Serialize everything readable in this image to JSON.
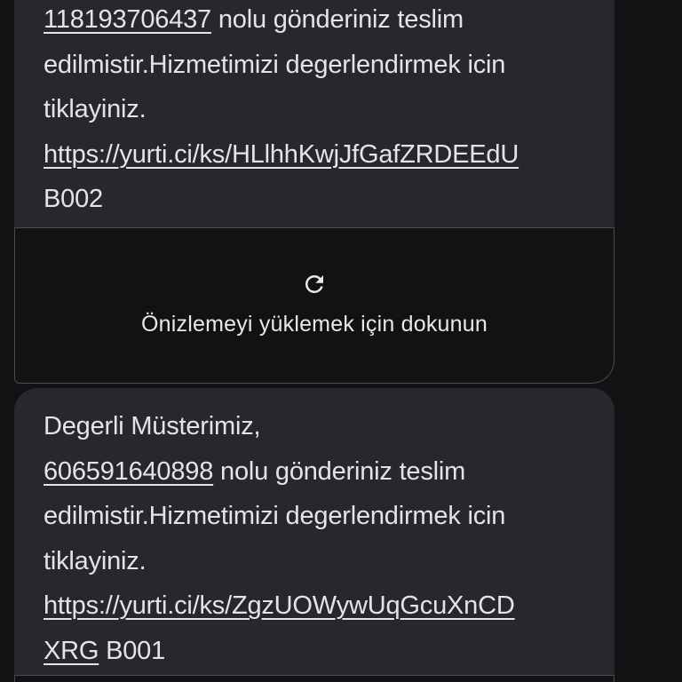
{
  "messages": [
    {
      "lines": [
        {
          "link": "118193706437",
          "text": " nolu gönderiniz teslim"
        },
        {
          "text": "edilmistir.Hizmetimizi degerlendirmek icin"
        },
        {
          "text": "tiklayiniz."
        },
        {
          "link": "https://yurti.ci/ks/HLlhhKwjJfGafZRDEEdU"
        },
        {
          "text": "B002"
        }
      ]
    },
    {
      "lines": [
        {
          "text": "Degerli Müsterimiz,"
        },
        {
          "link": "606591640898",
          "text": " nolu gönderiniz teslim"
        },
        {
          "text": "edilmistir.Hizmetimizi degerlendirmek icin"
        },
        {
          "text": "tiklayiniz."
        },
        {
          "link": "https://yurti.ci/ks/ZgzUOWywUqGcuXnCD"
        },
        {
          "link": "XRG",
          "text": " B001"
        }
      ]
    }
  ],
  "preview": {
    "label": "Önizlemeyi yüklemek için dokunun",
    "icon": "refresh-icon"
  },
  "colors": {
    "background": "#111214",
    "bubble": "#27282c",
    "text": "#e4e4e7",
    "card_border": "#4a4b50"
  }
}
